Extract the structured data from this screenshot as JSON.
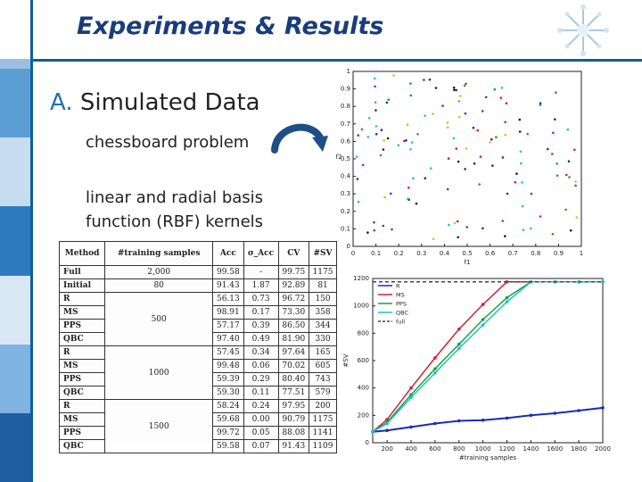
{
  "slide": {
    "title": "Experiments & Results",
    "heading_prefix": "A.",
    "heading": "Simulated Data",
    "sub1": "chessboard problem",
    "sub2_line1": "linear and radial basis",
    "sub2_line2": "function (RBF) kernels"
  },
  "colors": {
    "accent": "#0f5f9a",
    "title": "#1a3c7a",
    "arrow": "#1d4f86",
    "strip": [
      "#9bbfe0",
      "#5a9fd4",
      "#c7dcef",
      "#2e7ac0",
      "#d9e7f4",
      "#7fb3e0",
      "#1f5f9f"
    ]
  },
  "table": {
    "headers": [
      "Method",
      "#training samples",
      "Acc",
      "σ_Acc",
      "CV",
      "#SV"
    ],
    "rows": [
      {
        "method": "Full",
        "samples": "2,000",
        "acc": "99.58",
        "sd": "-",
        "cv": "99.75",
        "sv": "1175"
      },
      {
        "method": "Initial",
        "samples": "80",
        "acc": "91.43",
        "sd": "1.87",
        "cv": "92.89",
        "sv": "81"
      },
      {
        "method": "R",
        "samples": "500",
        "acc": "56.13",
        "sd": "0.73",
        "cv": "96.72",
        "sv": "150"
      },
      {
        "method": "MS",
        "samples": "",
        "acc": "98.91",
        "sd": "0.17",
        "cv": "73.30",
        "sv": "358"
      },
      {
        "method": "PPS",
        "samples": "",
        "acc": "57.17",
        "sd": "0.39",
        "cv": "86.50",
        "sv": "344"
      },
      {
        "method": "QBC",
        "samples": "",
        "acc": "97.40",
        "sd": "0.49",
        "cv": "81.90",
        "sv": "330"
      },
      {
        "method": "R",
        "samples": "1000",
        "acc": "57.45",
        "sd": "0.34",
        "cv": "97.64",
        "sv": "165"
      },
      {
        "method": "MS",
        "samples": "",
        "acc": "99.48",
        "sd": "0.06",
        "cv": "70.02",
        "sv": "605"
      },
      {
        "method": "PPS",
        "samples": "",
        "acc": "59.39",
        "sd": "0.29",
        "cv": "80.40",
        "sv": "743"
      },
      {
        "method": "QBC",
        "samples": "",
        "acc": "59.30",
        "sd": "0.11",
        "cv": "77.51",
        "sv": "579"
      },
      {
        "method": "R",
        "samples": "1500",
        "acc": "58.24",
        "sd": "0.24",
        "cv": "97.95",
        "sv": "200"
      },
      {
        "method": "MS",
        "samples": "",
        "acc": "59.68",
        "sd": "0.00",
        "cv": "90.79",
        "sv": "1175"
      },
      {
        "method": "PPS",
        "samples": "",
        "acc": "99.72",
        "sd": "0.05",
        "cv": "88.08",
        "sv": "1141"
      },
      {
        "method": "QBC",
        "samples": "",
        "acc": "59.58",
        "sd": "0.07",
        "cv": "91.43",
        "sv": "1109"
      }
    ]
  },
  "scatter": {
    "xlabel": "f1",
    "ylabel": "f2",
    "xticks": [
      "0",
      "0.1",
      "0.2",
      "0.3",
      "0.4",
      "0.5",
      "0.6",
      "0.7",
      "0.8",
      "0.9",
      "1"
    ],
    "yticks": [
      "0",
      "0.1",
      "0.2",
      "0.3",
      "0.4",
      "0.5",
      "0.6",
      "0.7",
      "0.8",
      "0.9",
      "1"
    ],
    "xlim": [
      0,
      1
    ],
    "ylim": [
      0,
      1
    ]
  },
  "chart_data": {
    "type": "line",
    "xlabel": "#training samples",
    "ylabel": "#SV",
    "xlim": [
      80,
      2000
    ],
    "ylim": [
      0,
      1200
    ],
    "xticks": [
      "200",
      "400",
      "600",
      "800",
      "1000",
      "1200",
      "1400",
      "1600",
      "1800",
      "2000"
    ],
    "yticks": [
      "0",
      "200",
      "400",
      "600",
      "800",
      "1000",
      "1200"
    ],
    "legend_position": "top-left",
    "series": [
      {
        "name": "R",
        "color": "#1a2bb8",
        "x": [
          80,
          200,
          400,
          600,
          800,
          1000,
          1200,
          1400,
          1600,
          1800,
          2000
        ],
        "y": [
          80,
          90,
          115,
          140,
          160,
          165,
          180,
          200,
          215,
          235,
          255
        ]
      },
      {
        "name": "MS",
        "color": "#d0203a",
        "x": [
          80,
          200,
          400,
          600,
          800,
          1000,
          1200,
          1400,
          1600,
          1800,
          2000
        ],
        "y": [
          80,
          170,
          400,
          620,
          830,
          1010,
          1175,
          1175,
          1175,
          1175,
          1175
        ]
      },
      {
        "name": "PPS",
        "color": "#18a040",
        "x": [
          80,
          200,
          400,
          600,
          800,
          1000,
          1200,
          1400,
          1600,
          1800,
          2000
        ],
        "y": [
          80,
          150,
          350,
          540,
          720,
          900,
          1060,
          1175,
          1175,
          1175,
          1175
        ]
      },
      {
        "name": "QBC",
        "color": "#20c0c8",
        "x": [
          80,
          200,
          400,
          600,
          800,
          1000,
          1200,
          1400,
          1600,
          1800,
          2000
        ],
        "y": [
          80,
          140,
          330,
          510,
          690,
          860,
          1030,
          1175,
          1175,
          1175,
          1175
        ]
      },
      {
        "name": "full",
        "color": "#444444",
        "x": [
          80,
          2000
        ],
        "y": [
          1175,
          1175
        ]
      }
    ]
  }
}
